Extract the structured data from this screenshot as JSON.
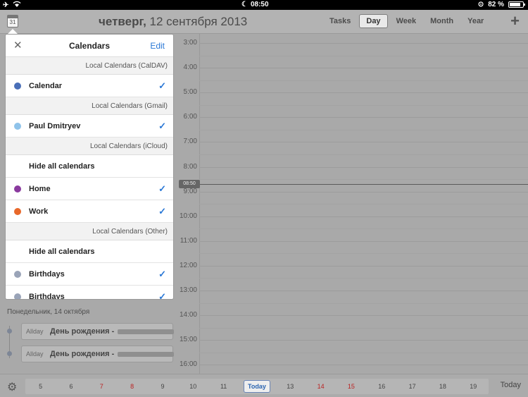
{
  "status": {
    "time": "08:50",
    "battery": "82 %",
    "battery_level": 0.82
  },
  "header": {
    "calendar_icon_day": "31",
    "date_weekday": "четверг,",
    "date_rest": " 12 сентября 2013",
    "views": [
      "Tasks",
      "Day",
      "Week",
      "Month",
      "Year"
    ],
    "active_view": "Day",
    "add_label": "+"
  },
  "hours": [
    "3:00",
    "4:00",
    "5:00",
    "6:00",
    "7:00",
    "8:00",
    "9:00",
    "10:00",
    "11:00",
    "12:00",
    "13:00",
    "14:00",
    "15:00",
    "16:00"
  ],
  "now_badge": "08:50",
  "popover": {
    "close_label": "✕",
    "title": "Calendars",
    "edit_label": "Edit",
    "sections": [
      {
        "header": "Local Calendars (CalDAV)",
        "rows": [
          {
            "label": "Calendar",
            "color": "#4a6fb8",
            "checked": true
          }
        ]
      },
      {
        "header": "Local Calendars (Gmail)",
        "rows": [
          {
            "label": "Paul Dmitryev",
            "color": "#8fc3ea",
            "checked": true
          }
        ]
      },
      {
        "header": "Local Calendars (iCloud)",
        "rows": [
          {
            "label": "Hide all calendars",
            "color": null,
            "checked": false
          },
          {
            "label": "Home",
            "color": "#8a3a9e",
            "checked": true
          },
          {
            "label": "Work",
            "color": "#e8682a",
            "checked": true
          }
        ]
      },
      {
        "header": "Local Calendars (Other)",
        "rows": [
          {
            "label": "Hide all calendars",
            "color": null,
            "checked": false
          },
          {
            "label": "Birthdays",
            "color": "#9aa4b8",
            "checked": true
          },
          {
            "label": "Birthdays",
            "color": "#9aa4b8",
            "checked": true
          }
        ]
      }
    ]
  },
  "events": {
    "day_heading": "Понедельник, 14 октября",
    "items": [
      {
        "allday": "Allday",
        "title": "День рождения -"
      },
      {
        "allday": "Allday",
        "title": "День рождения -"
      }
    ]
  },
  "bottom": {
    "days": [
      {
        "n": "5",
        "red": false
      },
      {
        "n": "6",
        "red": false
      },
      {
        "n": "7",
        "red": true
      },
      {
        "n": "8",
        "red": true
      },
      {
        "n": "9",
        "red": false
      },
      {
        "n": "10",
        "red": false
      },
      {
        "n": "11",
        "red": false
      },
      {
        "n": "Today",
        "red": false,
        "today": true
      },
      {
        "n": "13",
        "red": false
      },
      {
        "n": "14",
        "red": true
      },
      {
        "n": "15",
        "red": true
      },
      {
        "n": "16",
        "red": false
      },
      {
        "n": "17",
        "red": false
      },
      {
        "n": "18",
        "red": false
      },
      {
        "n": "19",
        "red": false
      }
    ],
    "today_button": "Today"
  }
}
